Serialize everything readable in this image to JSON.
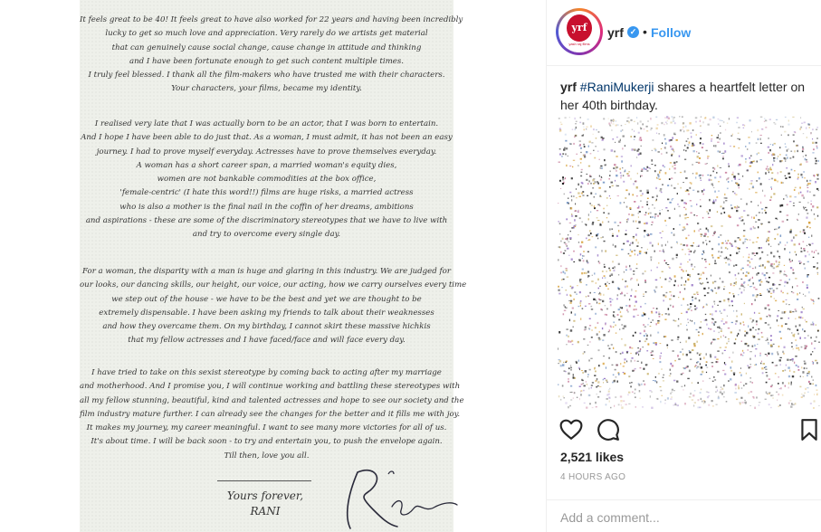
{
  "letter": {
    "paragraphs": [
      [
        "It feels great to be 40! It feels great to have also worked for 22 years and having been incredibly",
        "lucky to get so much love and appreciation. Very rarely do we artists get material",
        "that can genuinely cause social change, cause change in attitude and thinking",
        "and I have been fortunate enough to get such content multiple times.",
        "I truly feel blessed. I thank all the film-makers who have trusted me with their characters.",
        "Your characters, your films, became my identity."
      ],
      [
        "I realised very late that I was actually born to be an actor, that I was born to entertain.",
        "And I hope I have been able to do just that. As a woman, I must admit, it has not been an easy",
        "journey. I had to prove myself everyday. Actresses have to prove themselves everyday.",
        "A woman has a short career span, a married woman's equity dies,",
        "women are not bankable commodities at the box office,",
        "'female-centric' (I hate this word!!) films are huge risks, a married actress",
        "who is also a mother is the final nail in the coffin of her dreams, ambitions",
        "and aspirations - these are some of the discriminatory stereotypes that we have to live with",
        "and try to overcome every single day."
      ],
      [
        "For a woman, the disparity with a man is huge and glaring in this industry. We are judged for",
        "our looks, our dancing skills, our height, our voice, our acting, how we carry ourselves every time",
        "we step out of the house - we have to be the best and yet we are thought to be",
        "extremely dispensable. I have been asking my friends to talk about their weaknesses",
        "and how they overcame them. On my birthday, I cannot skirt these massive hichkis",
        "that my fellow actresses and I have faced/face and will face every day."
      ],
      [
        "I have tried to take on this sexist stereotype by coming back to acting after my marriage",
        "and motherhood. And I promise you, I will continue working and battling these stereotypes with",
        "all my fellow stunning, beautiful, kind and talented actresses and hope to see our society and the",
        "film industry mature further. I can already see the changes for the better and it fills me with joy.",
        "It makes my journey, my career meaningful. I want to see many more victories for all of us.",
        "It's about time. I will be back soon - to try and entertain you, to push the envelope again.",
        "Till then, love you all."
      ]
    ],
    "closing": "Yours forever,",
    "signed_name": "RANI"
  },
  "post": {
    "username": "yrf",
    "follow_label": "Follow",
    "separator": "•",
    "avatar_logo_text": "yrf",
    "avatar_caption": "yash raj films",
    "caption_user": "yrf",
    "caption_hashtag": "#RaniMukerji",
    "caption_text": " shares a heartfelt letter on her 40th birthday.",
    "likes": "2,521 likes",
    "time_ago": "4 HOURS AGO",
    "comment_placeholder": "Add a comment..."
  },
  "colors": {
    "link_blue": "#3897f0",
    "hashtag": "#003569",
    "brand_red": "#c8102e"
  },
  "icons": [
    "heart-icon",
    "comment-icon",
    "bookmark-icon",
    "verified-icon"
  ]
}
